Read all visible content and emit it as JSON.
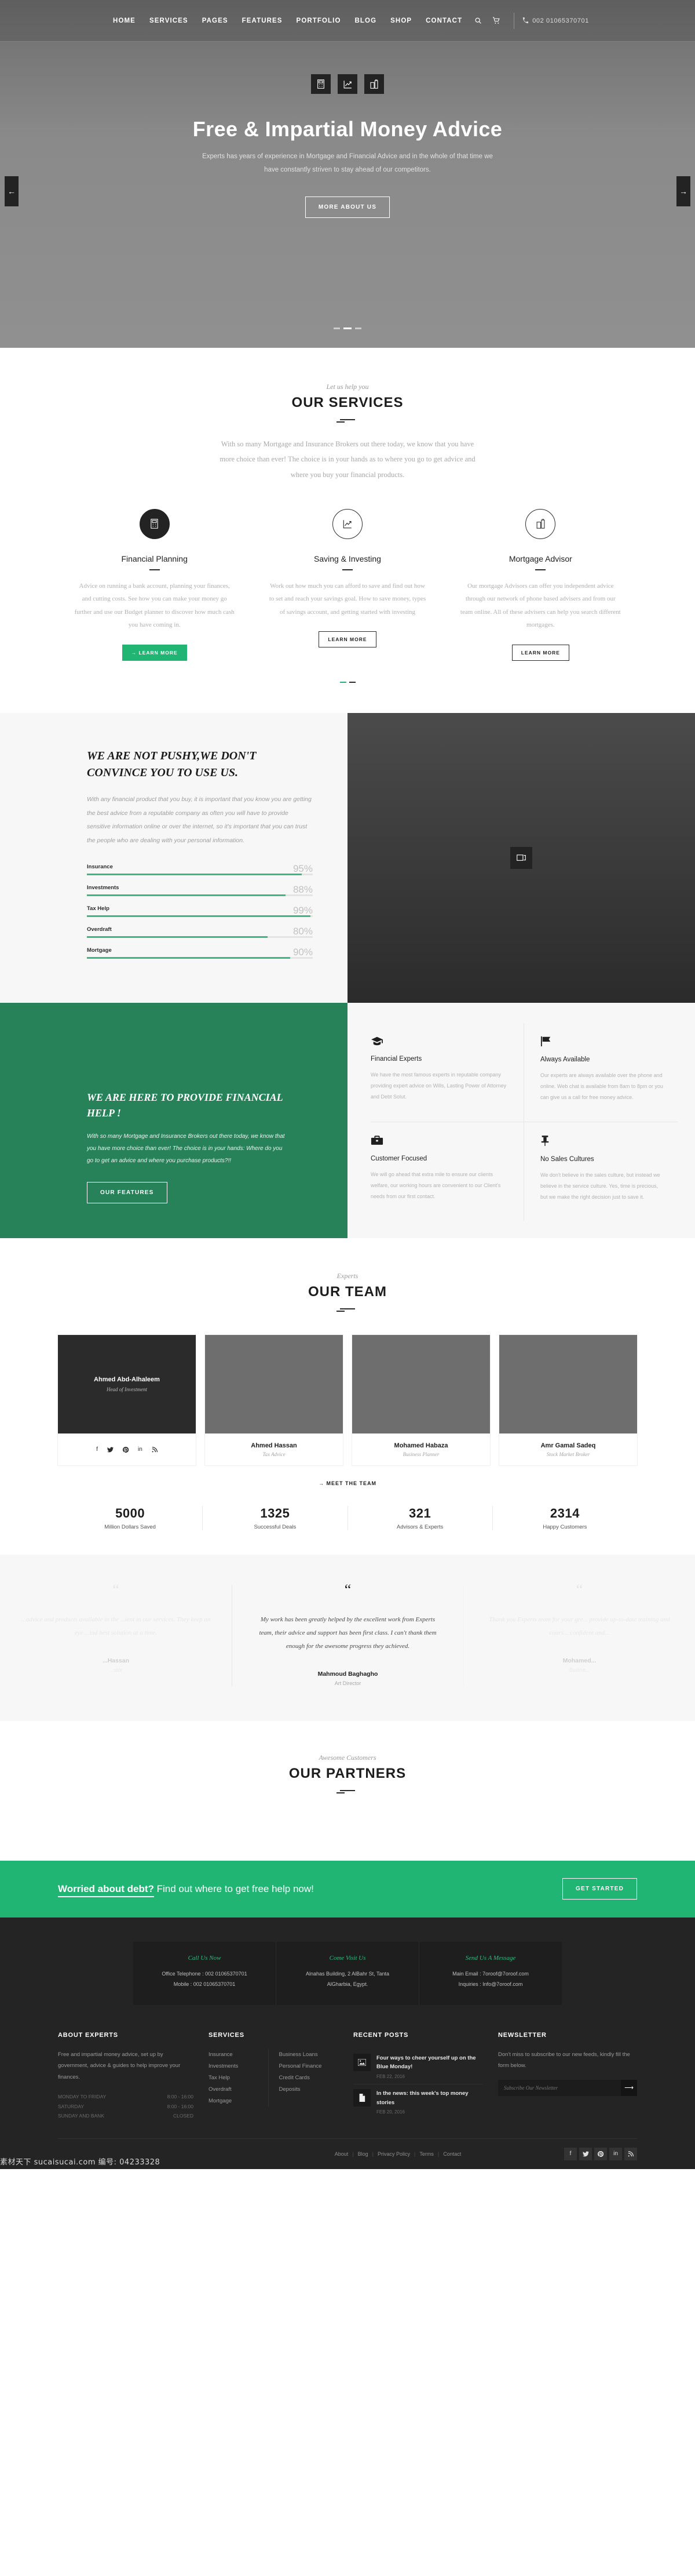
{
  "brand": {
    "accent_green": "#21b573",
    "dark_green": "#288259",
    "dark": "#242424"
  },
  "nav": {
    "items": [
      "HOME",
      "SERVICES",
      "PAGES",
      "FEATURES",
      "PORTFOLIO",
      "BLOG",
      "SHOP",
      "CONTACT"
    ],
    "phone": "002 01065370701"
  },
  "hero": {
    "title": "Free & Impartial Money Advice",
    "subtitle": "Experts has years of experience in Mortgage and Financial Advice and in the whole of that time we have constantly striven to stay ahead of our competitors.",
    "button": "MORE ABOUT US"
  },
  "services": {
    "eyebrow": "Let us help you",
    "title": "OUR SERVICES",
    "intro": "With so many Mortgage and Insurance Brokers out there today, we know that you have more choice than ever! The choice is in your hands as to where you go to get advice and where you buy your financial products.",
    "cards": [
      {
        "icon": "calculator-icon",
        "name": "Financial Planning",
        "text": "Advice on running a bank account, planning your finances, and cutting costs. See how you can make your money go further and use our Budget planner to discover how much cash you have coming in.",
        "button": "→ LEARN MORE"
      },
      {
        "icon": "growth-chart-icon",
        "name": "Saving & Investing",
        "text": "Work out how much you can afford to save and find out how to set and reach your savings goal. How to save money, types of savings account, and getting started with investing",
        "button": "LEARN MORE"
      },
      {
        "icon": "buildings-icon",
        "name": "Mortgage Advisor",
        "text": "Our mortgage Advisors can offer you independent advice through our network of phone based advisers and from our team online. All of these advisers can help you search different mortgages.",
        "button": "LEARN MORE"
      }
    ]
  },
  "pushy": {
    "title": "WE ARE NOT PUSHY,WE DON'T CONVINCE YOU TO USE US.",
    "text": "With any financial product that you buy, it is important that you know you are getting the best advice from a reputable company as often you will have to provide sensitive information online or over the internet, so it's important that you can trust the people who are dealing with your personal information.",
    "skills": [
      {
        "label": "Insurance",
        "value": 95,
        "display": "95%"
      },
      {
        "label": "Investments",
        "value": 88,
        "display": "88%"
      },
      {
        "label": "Tax Help",
        "value": 99,
        "display": "99%"
      },
      {
        "label": "Overdraft",
        "value": 80,
        "display": "80%"
      },
      {
        "label": "Mortgage",
        "value": 90,
        "display": "90%"
      }
    ]
  },
  "help": {
    "title": "WE ARE HERE TO PROVIDE FINANCIAL HELP !",
    "text": "With so many Mortgage and Insurance Brokers out there today, we know that you have more choice than ever! The choice is in your hands: Where do you go to get an advice and where you purchase products?!!",
    "button": "OUR FEATURES",
    "features": [
      {
        "icon": "graduation-cap-icon",
        "name": "Financial Experts",
        "text": "We have the most famous experts in reputable company providing expert advice on Wills, Lasting Power of Attorney and Debt Solut."
      },
      {
        "icon": "flag-icon",
        "name": "Always Available",
        "text": "Our experts are always available over the phone and online. Web chat is available from 8am to 8pm or you can give us a call for free money advice."
      },
      {
        "icon": "briefcase-icon",
        "name": "Customer Focused",
        "text": "We will go ahead that extra mile to ensure our clients welfare, our working hours are convenient to our Client's needs from our first contact."
      },
      {
        "icon": "pin-icon",
        "name": "No Sales Cultures",
        "text": "We don't believe in the sales culture, but instead we believe in the service culture. Yes, time is precious, but we make the right decision just to save it."
      }
    ]
  },
  "team": {
    "eyebrow": "Experts",
    "title": "OUR TEAM",
    "members": [
      {
        "name": "Ahmed Abd-Alhaleem",
        "role": "Head of Investment",
        "active": true
      },
      {
        "name": "Ahmed Hassan",
        "role": "Tax Advice",
        "active": false
      },
      {
        "name": "Mohamed Habaza",
        "role": "Business Planner",
        "active": false
      },
      {
        "name": "Amr Gamal Sadeq",
        "role": "Stock Market Broker",
        "active": false
      }
    ],
    "social": [
      "facebook-icon",
      "twitter-icon",
      "pinterest-icon",
      "linkedin-icon",
      "rss-icon"
    ],
    "meet_label": "→ MEET THE TEAM",
    "counters": [
      {
        "num": "5000",
        "label": "Million Dollars Saved"
      },
      {
        "num": "1325",
        "label": "Successful Deals"
      },
      {
        "num": "321",
        "label": "Advisors & Experts"
      },
      {
        "num": "2314",
        "label": "Happy Customers"
      }
    ]
  },
  "testimonials": [
    {
      "text": "...advice and products available in the ...ient in our services. They keep an eye ...ind best solution at a time.",
      "name": "...Hassan",
      "role": "...stor"
    },
    {
      "text": "My work has been greatly helped by the excellent work from Experts team, their advice and support has been first class. I can't thank them enough for the awesome progress they achieved.",
      "name": "Mahmoud Baghagho",
      "role": "Art Director"
    },
    {
      "text": "Thank you Experts team for your gre... provide up-to-date training and cours... confident and...",
      "name": "Mohamed...",
      "role": "Busine..."
    }
  ],
  "partners": {
    "eyebrow": "Awesome Customers",
    "title": "OUR PARTNERS"
  },
  "cta": {
    "strong": "Worried about debt?",
    "rest": " Find out where to get free help now!",
    "button": "GET STARTED"
  },
  "contact": [
    {
      "title": "Call Us Now",
      "lines": [
        "Office Telephone : 002 01065370701",
        "Mobile : 002 01065370701"
      ]
    },
    {
      "title": "Come Visit Us",
      "lines": [
        "Alnahas Building, 2 AlBahr St, Tanta",
        "AlGharbia, Egypt."
      ]
    },
    {
      "title": "Send Us A Message",
      "lines": [
        "Main Email : 7oroof@7oroof.com",
        "Inquiries : Info@7oroof.com"
      ]
    }
  ],
  "footer": {
    "about": {
      "title": "ABOUT EXPERTS",
      "text": "Free and impartial money advice, set up by government, advice & guides to help improve your finances.",
      "hours": [
        {
          "day": "MONDAY TO FRIDAY",
          "time": "8:00 - 16:00"
        },
        {
          "day": "SATURDAY",
          "time": "8:00 - 16:00"
        },
        {
          "day": "SUNDAY AND BANK",
          "time": "CLOSED"
        }
      ]
    },
    "services": {
      "title": "SERVICES",
      "col1": [
        "Insurance",
        "Investments",
        "Tax Help",
        "Overdraft",
        "Mortgage"
      ],
      "col2": [
        "Business Loans",
        "Personal Finance",
        "Credit Cards",
        "Deposits"
      ]
    },
    "posts": {
      "title": "RECENT POSTS",
      "items": [
        {
          "icon": "image-icon",
          "title": "Four ways to cheer yourself up on the Blue Monday!",
          "date": "FEB 22, 2016"
        },
        {
          "icon": "document-icon",
          "title": "In the news: this week's top money stories",
          "date": "FEB 20, 2016"
        }
      ]
    },
    "newsletter": {
      "title": "NEWSLETTER",
      "text": "Don't miss to subscribe to our new feeds, kindly fill the form below.",
      "placeholder": "Subscribe Our Newsletter",
      "button_icon": "arrow-right-icon"
    },
    "bottom_links": [
      "About",
      "Blog",
      "Privacy Policy",
      "Terms",
      "Contact"
    ],
    "bottom_social": [
      "facebook-icon",
      "twitter-icon",
      "pinterest-icon",
      "linkedin-icon",
      "rss-icon"
    ],
    "watermark": "素材天下 sucaisucai.com 编号: 04233328"
  }
}
